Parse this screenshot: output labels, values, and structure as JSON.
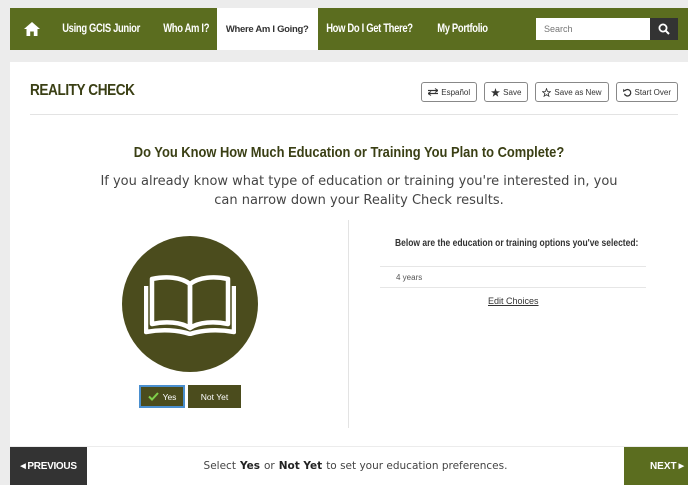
{
  "nav": {
    "home_icon": "home-icon",
    "items": [
      {
        "label": "Using GCIS Junior",
        "active": false
      },
      {
        "label": "Who Am I?",
        "active": false
      },
      {
        "label": "Where Am I Going?",
        "active": true
      },
      {
        "label": "How Do I Get There?",
        "active": false
      },
      {
        "label": "My Portfolio",
        "active": false
      }
    ],
    "search_placeholder": "Search",
    "search_icon": "search-icon"
  },
  "page": {
    "title": "REALITY CHECK",
    "tools": {
      "espanol": "Español",
      "save": "Save",
      "save_as_new": "Save as New",
      "start_over": "Start Over"
    },
    "question": "Do You Know How Much Education or Training You Plan to Complete?",
    "subtext": "If you already know what type of education or training you're interested in, you can narrow down your Reality Check results.",
    "book_icon": "open-book-icon",
    "yes_label": "Yes",
    "not_yet_label": "Not Yet"
  },
  "selection": {
    "heading": "Below are the education or training options you've selected:",
    "items": [
      "4 years"
    ],
    "edit_label": "Edit Choices"
  },
  "footer": {
    "previous": "PREVIOUS",
    "status_prefix": "Select",
    "status_yes": "Yes",
    "status_or": "or",
    "status_notyet": "Not Yet",
    "status_suffix": "to set your education preferences.",
    "next": "NEXT"
  },
  "colors": {
    "nav_bg": "#5b6d1f",
    "dark_olive": "#4b4c1d",
    "title_text": "#3a3f14",
    "focus_border": "#4a8fcf"
  }
}
